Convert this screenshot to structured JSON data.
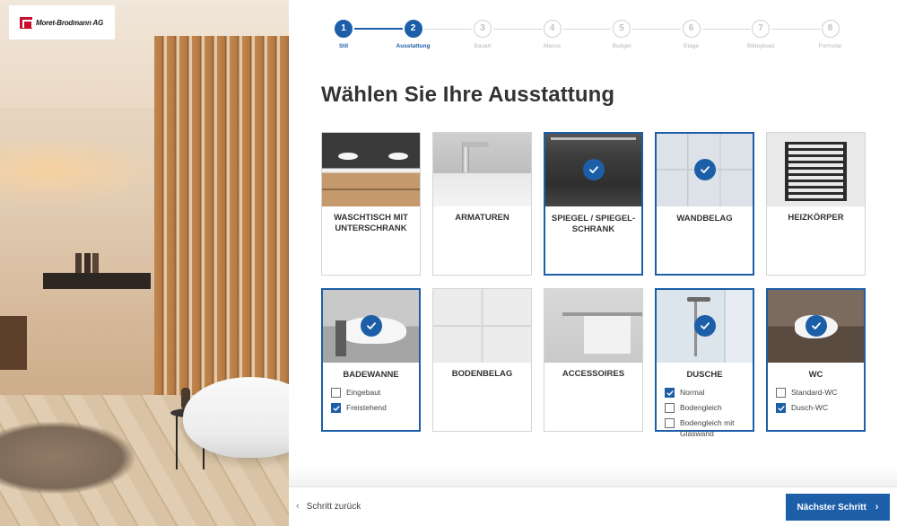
{
  "brand": {
    "name": "Moret-Brodmann AG"
  },
  "stepper": {
    "steps": [
      {
        "number": "1",
        "label": "Stil",
        "active": true
      },
      {
        "number": "2",
        "label": "Ausstattung",
        "active": true
      },
      {
        "number": "3",
        "label": "Bauart",
        "active": false
      },
      {
        "number": "4",
        "label": "Masse",
        "active": false
      },
      {
        "number": "5",
        "label": "Budget",
        "active": false
      },
      {
        "number": "6",
        "label": "Etage",
        "active": false
      },
      {
        "number": "7",
        "label": "Bildupload",
        "active": false
      },
      {
        "number": "8",
        "label": "Formular",
        "active": false
      }
    ]
  },
  "page": {
    "title": "Wählen Sie Ihre Ausstattung"
  },
  "cards": [
    {
      "title": "Waschtisch mit Unterschrank",
      "selected": false,
      "image": "washbasin-cabinet"
    },
    {
      "title": "Armaturen",
      "selected": false,
      "image": "faucet"
    },
    {
      "title": "Spiegel / Spiegel-schrank",
      "selected": true,
      "image": "mirror-cabinet"
    },
    {
      "title": "Wandbelag",
      "selected": true,
      "image": "wall-tiles"
    },
    {
      "title": "Heizkörper",
      "selected": false,
      "image": "radiator"
    },
    {
      "title": "Badewanne",
      "selected": true,
      "image": "bathtub",
      "options": [
        {
          "label": "Eingebaut",
          "checked": false
        },
        {
          "label": "Freistehend",
          "checked": true
        }
      ]
    },
    {
      "title": "Bodenbelag",
      "selected": false,
      "image": "floor-tiles"
    },
    {
      "title": "Accessoires",
      "selected": false,
      "image": "towel-rail"
    },
    {
      "title": "Dusche",
      "selected": true,
      "image": "shower",
      "options": [
        {
          "label": "Normal",
          "checked": true
        },
        {
          "label": "Bodengleich",
          "checked": false
        },
        {
          "label": "Bodengleich mit Glaswand",
          "checked": false
        }
      ]
    },
    {
      "title": "WC",
      "selected": true,
      "image": "toilet",
      "options": [
        {
          "label": "Standard-WC",
          "checked": false
        },
        {
          "label": "Dusch-WC",
          "checked": true
        }
      ]
    }
  ],
  "nav": {
    "back_label": "Schritt zurück",
    "next_label": "Nächster Schritt"
  },
  "colors": {
    "accent": "#1c5fa8",
    "brand_red": "#c8102e",
    "text": "#333333"
  }
}
